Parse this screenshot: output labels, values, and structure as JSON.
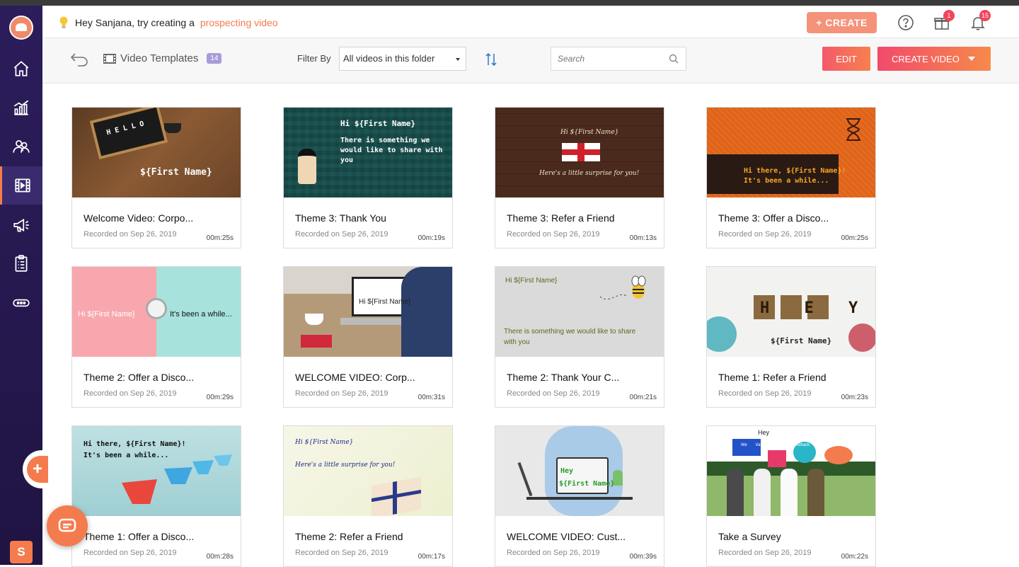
{
  "header": {
    "hint_prefix": "Hey Sanjana, try creating a",
    "hint_link": "prospecting video",
    "create_label": "+ CREATE",
    "gift_badge": "1",
    "bell_badge": "15"
  },
  "toolbar": {
    "title": "Video Templates",
    "count": "14",
    "filter_label": "Filter By",
    "filter_value": "All videos in this folder",
    "search_placeholder": "Search",
    "edit_label": "EDIT",
    "create_video_label": "CREATE VIDEO"
  },
  "sidebar": {
    "user_initial": "S"
  },
  "cards": [
    {
      "title": "Welcome Video: Corpo...",
      "date": "Recorded on Sep 26, 2019",
      "duration": "00m:25s",
      "thumb_text": "${First Name}",
      "thumb_text2": "H E L L O"
    },
    {
      "title": "Theme 3: Thank You",
      "date": "Recorded on Sep 26, 2019",
      "duration": "00m:19s",
      "thumb_text": "Hi ${First Name}",
      "thumb_text2": "There is something we would like to share with you"
    },
    {
      "title": "Theme 3: Refer a Friend",
      "date": "Recorded on Sep 26, 2019",
      "duration": "00m:13s",
      "thumb_text": "Hi ${First Name}",
      "thumb_text2": "Here's a little surprise for you!"
    },
    {
      "title": "Theme 3: Offer a Disco...",
      "date": "Recorded on Sep 26, 2019",
      "duration": "00m:25s",
      "thumb_text": "Hi there, ${First Name}!",
      "thumb_text2": "It's been a while..."
    },
    {
      "title": "Theme 2: Offer a Disco...",
      "date": "Recorded on Sep 26, 2019",
      "duration": "00m:29s",
      "thumb_text": "Hi ${First Name}",
      "thumb_text2": "It's been a while..."
    },
    {
      "title": "WELCOME VIDEO: Corp...",
      "date": "Recorded on Sep 26, 2019",
      "duration": "00m:31s",
      "thumb_text": "Hi ${First Name}",
      "thumb_text2": ""
    },
    {
      "title": "Theme 2: Thank Your C...",
      "date": "Recorded on Sep 26, 2019",
      "duration": "00m:21s",
      "thumb_text": "Hi ${First Name}",
      "thumb_text2": "There is something we would like to share with you"
    },
    {
      "title": "Theme 1: Refer a Friend",
      "date": "Recorded on Sep 26, 2019",
      "duration": "00m:23s",
      "thumb_text": "${First Name}",
      "thumb_text2": "H E Y"
    },
    {
      "title": "Theme 1: Offer a Disco...",
      "date": "Recorded on Sep 26, 2019",
      "duration": "00m:28s",
      "thumb_text": "Hi there, ${First Name}!",
      "thumb_text2": "It's been a while..."
    },
    {
      "title": "Theme 2: Refer a Friend",
      "date": "Recorded on Sep 26, 2019",
      "duration": "00m:17s",
      "thumb_text": "Hi ${First Name}",
      "thumb_text2": "Here's a little surprise for you!"
    },
    {
      "title": "WELCOME VIDEO: Cust...",
      "date": "Recorded on Sep 26, 2019",
      "duration": "00m:39s",
      "thumb_text": "Hey",
      "thumb_text2": "${First Name}"
    },
    {
      "title": "Take a Survey",
      "date": "Recorded on Sep 26, 2019",
      "duration": "00m:22s",
      "thumb_text": "Hey",
      "thumb_text2": "We Value Your Feedback"
    }
  ]
}
